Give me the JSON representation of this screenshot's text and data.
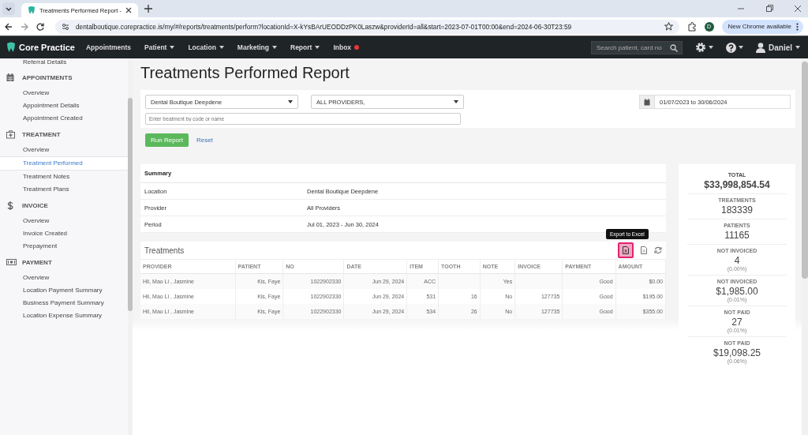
{
  "browser": {
    "tab_title": "Treatments Performed Report -",
    "url": "dentalboutique.corepractice.is/my/#/reports/treatments/perform?locationId=X-kYsBArUEODDzPK0Laszw&providerId=all&start=2023-07-01T00:00&end=2024-06-30T23:59",
    "profile_initial": "D",
    "update_button": "New Chrome available"
  },
  "navbar": {
    "brand": "Core Practice",
    "items": [
      {
        "label": "Appointments",
        "dropdown": false,
        "alert": false
      },
      {
        "label": "Patient",
        "dropdown": true,
        "alert": false
      },
      {
        "label": "Location",
        "dropdown": true,
        "alert": false
      },
      {
        "label": "Marketing",
        "dropdown": true,
        "alert": false
      },
      {
        "label": "Report",
        "dropdown": true,
        "alert": false
      },
      {
        "label": "Inbox",
        "dropdown": false,
        "alert": true
      }
    ],
    "search_placeholder": "Search patient, card no",
    "user": "Daniel"
  },
  "sidebar": {
    "top_item": "Referral Details",
    "sections": [
      {
        "title": "APPOINTMENTS",
        "items": [
          {
            "label": "Overview",
            "selected": false
          },
          {
            "label": "Appointment Details",
            "selected": false
          },
          {
            "label": "Appointment Created",
            "selected": false
          }
        ]
      },
      {
        "title": "TREATMENT",
        "items": [
          {
            "label": "Overview",
            "selected": false
          },
          {
            "label": "Treatment Performed",
            "selected": true
          },
          {
            "label": "Treatment Notes",
            "selected": false
          },
          {
            "label": "Treatment Plans",
            "selected": false
          }
        ]
      },
      {
        "title": "INVOICE",
        "items": [
          {
            "label": "Overview",
            "selected": false
          },
          {
            "label": "Invoice Created",
            "selected": false
          },
          {
            "label": "Prepayment",
            "selected": false
          }
        ]
      },
      {
        "title": "PAYMENT",
        "items": [
          {
            "label": "Overview",
            "selected": false
          },
          {
            "label": "Location Payment Summary",
            "selected": false
          },
          {
            "label": "Business Payment Summary",
            "selected": false
          },
          {
            "label": "Location Expense Summary",
            "selected": false
          }
        ]
      }
    ]
  },
  "report": {
    "title": "Treatments Performed Report",
    "filters": {
      "location": "Dental Boutique Deepdene",
      "provider": "ALL PROVIDERS,",
      "treatment_placeholder": "Enter treatment by code or name",
      "date_range": "01/07/2023 to 30/06/2024"
    },
    "run_button": "Run Report",
    "reset_link": "Reset",
    "summary": {
      "title": "Summary",
      "rows": [
        {
          "label": "Location",
          "value": "Dental Boutique Deepdene"
        },
        {
          "label": "Provider",
          "value": "All Providers"
        },
        {
          "label": "Period",
          "value": "Jul 01, 2023 - Jun 30, 2024"
        }
      ]
    },
    "treatments": {
      "title": "Treatments",
      "tooltip": "Export to Excel",
      "columns": [
        "PROVIDER",
        "PATIENT",
        "NO",
        "DATE",
        "ITEM",
        "TOOTH",
        "NOTE",
        "INVOICE",
        "PAYMENT",
        "AMOUNT"
      ],
      "rows": [
        [
          "Hii, Mao Li , Jasmine",
          "Kis, Faye",
          "1022902330",
          "Jun 29, 2024",
          "ACC",
          "",
          "Yes",
          "",
          "Good",
          "$0.00"
        ],
        [
          "Hii, Mao Li , Jasmine",
          "Kis, Faye",
          "1022902330",
          "Jun 29, 2024",
          "531",
          "16",
          "No",
          "127735",
          "Good",
          "$195.00"
        ],
        [
          "Hii, Mao Li , Jasmine",
          "Kis, Faye",
          "1022902330",
          "Jun 29, 2024",
          "534",
          "26",
          "No",
          "127735",
          "Good",
          "$355.00"
        ]
      ]
    },
    "stats": [
      {
        "label": "TOTAL",
        "value": "$33,998,854.54",
        "kind": "main"
      },
      {
        "label": "TREATMENTS",
        "value": "183339",
        "kind": "plain"
      },
      {
        "label": "PATIENTS",
        "value": "11165",
        "kind": "plain"
      },
      {
        "label": "NOT INVOICED",
        "value": "4",
        "note": "(0.00%)",
        "kind": "plain"
      },
      {
        "label": "NOT INVOICED",
        "value": "$1,985.00",
        "note": "(0.01%)",
        "kind": "plain"
      },
      {
        "label": "NOT PAID",
        "value": "27",
        "note": "(0.01%)",
        "kind": "plain"
      },
      {
        "label": "NOT PAID",
        "value": "$19,098.25",
        "note": "(0.06%)",
        "kind": "plain"
      }
    ]
  }
}
